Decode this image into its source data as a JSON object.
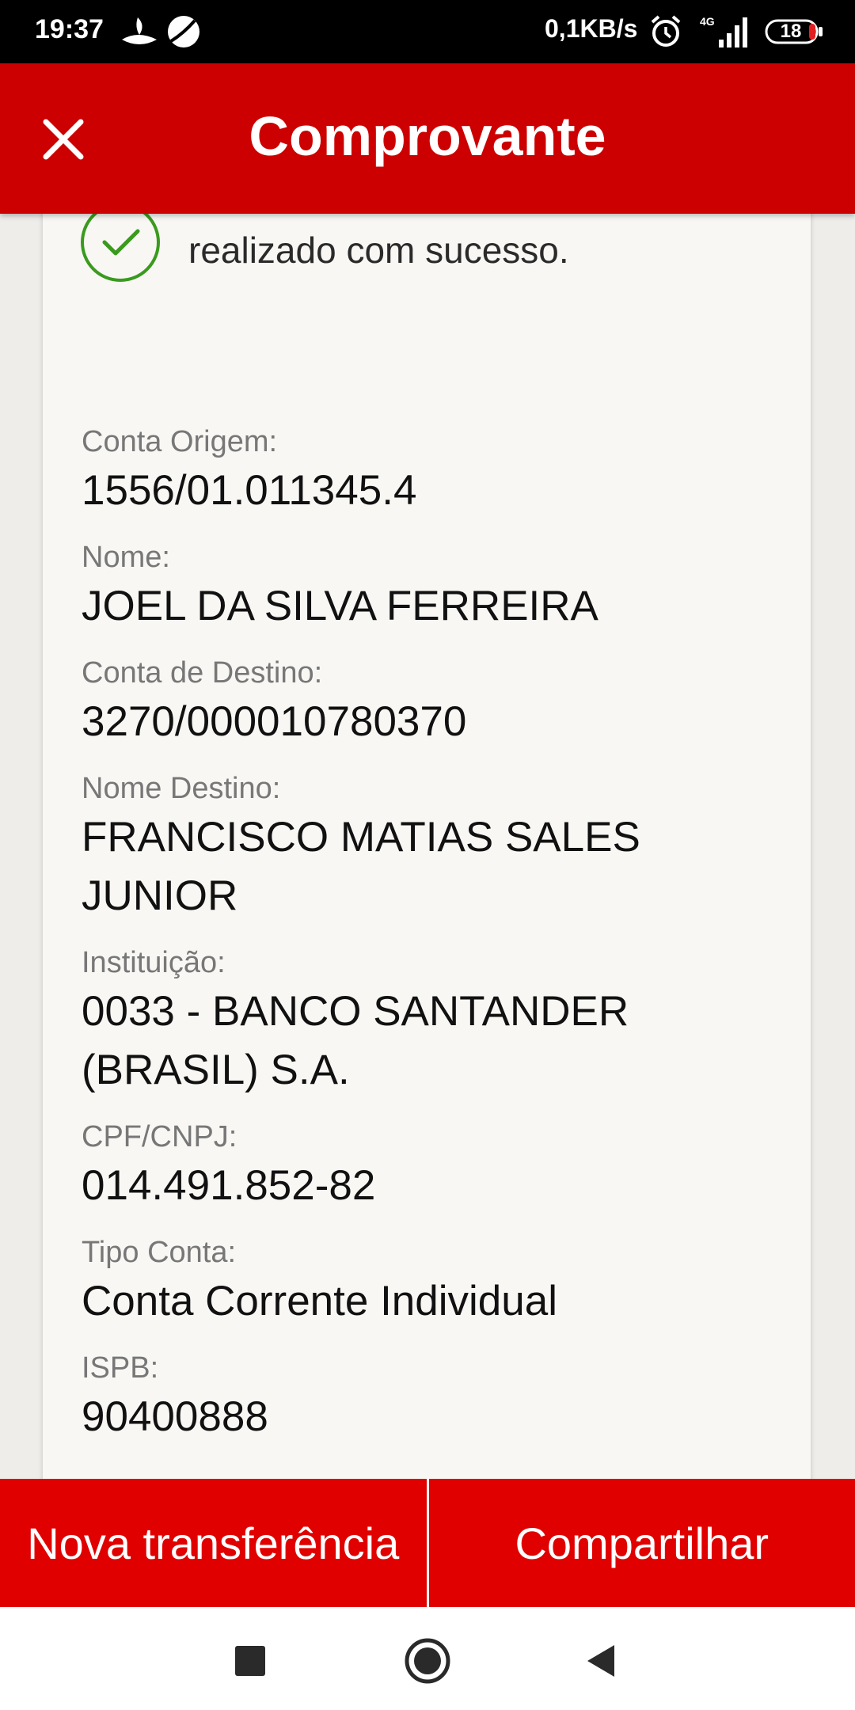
{
  "status_bar": {
    "time": "19:37",
    "network_speed": "0,1KB/s",
    "network_type": "4G",
    "battery_level": "18",
    "icons": [
      "santander-icon",
      "chat-icon",
      "alarm-icon",
      "signal-icon",
      "battery-icon"
    ]
  },
  "header": {
    "title": "Comprovante",
    "close_icon": "close-icon"
  },
  "receipt": {
    "success_message": "Transferência entre contas realizado com sucesso.",
    "fields": [
      {
        "label": "Conta Origem:",
        "value": "1556/01.011345.4"
      },
      {
        "label": "Nome:",
        "value": "JOEL DA SILVA FERREIRA"
      },
      {
        "label": "Conta de Destino:",
        "value": "3270/000010780370"
      },
      {
        "label": "Nome Destino:",
        "value": "FRANCISCO MATIAS SALES JUNIOR"
      },
      {
        "label": "Instituição:",
        "value": "0033 - BANCO SANTANDER (BRASIL) S.A."
      },
      {
        "label": "CPF/CNPJ:",
        "value": "014.491.852-82"
      },
      {
        "label": "Tipo Conta:",
        "value": "Conta Corrente Individual"
      },
      {
        "label": "ISPB:",
        "value": "90400888"
      }
    ]
  },
  "footer": {
    "new_transfer_label": "Nova transferência",
    "share_label": "Compartilhar"
  },
  "colors": {
    "brand_red": "#cc0000",
    "button_red": "#e00000",
    "success_green": "#3a9a1e"
  }
}
